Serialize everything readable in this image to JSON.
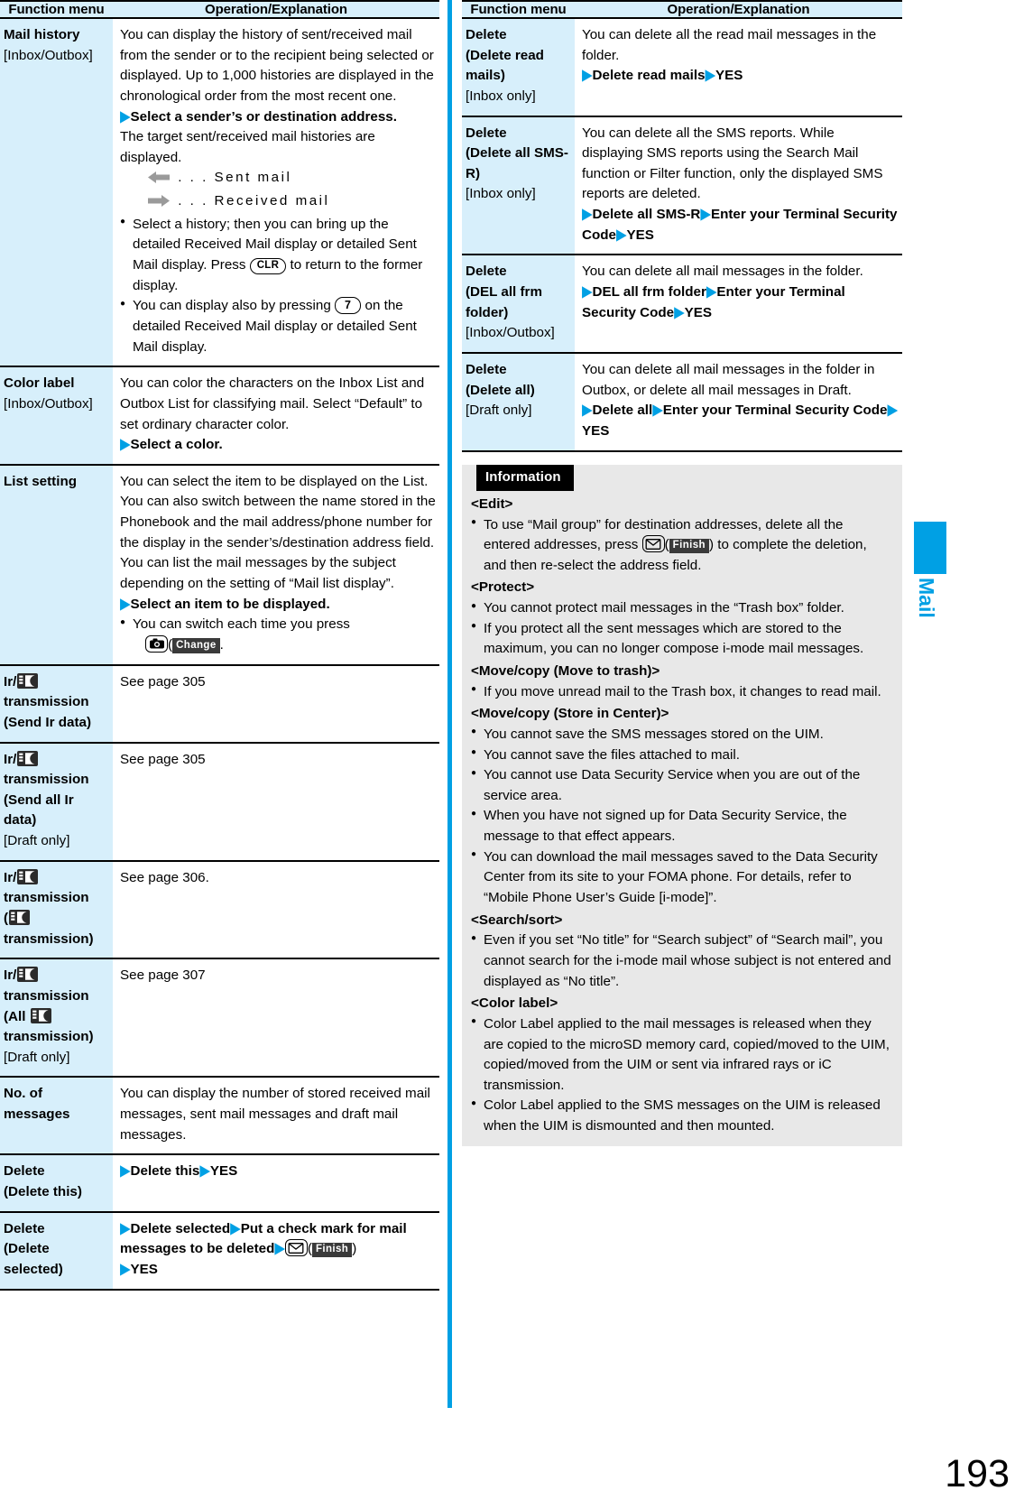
{
  "page": {
    "number": "193",
    "side_tab_label": "Mail"
  },
  "table_headers": {
    "function_menu": "Function menu",
    "operation": "Operation/Explanation"
  },
  "left_column": {
    "rows": [
      {
        "menu_title": "Mail history",
        "menu_scope": "[Inbox/Outbox]",
        "para1": "You can display the history of sent/received mail from the sender or to the recipient being selected or displayed. Up to 1,000 histories are displayed in the chronological order from the most recent one.",
        "step1": "Select a sender’s or destination address.",
        "para2": "The target sent/received mail histories are displayed.",
        "legend_sent": ". . . Sent mail",
        "legend_received": ". . . Received mail",
        "bullet1_a": "Select a history; then you can bring up the detailed Received Mail display or detailed Sent Mail display. Press ",
        "bullet1_key": "CLR",
        "bullet1_b": " to return to the former display.",
        "bullet2_a": "You can display also by pressing ",
        "bullet2_key": "7",
        "bullet2_b": " on the detailed Received Mail display or detailed Sent Mail display."
      },
      {
        "menu_title": "Color label",
        "menu_scope": "[Inbox/Outbox]",
        "para1": "You can color the characters on the Inbox List and Outbox List for classifying mail. Select “Default” to set ordinary character color.",
        "step1": "Select a color."
      },
      {
        "menu_title": "List setting",
        "menu_scope": "",
        "para1": "You can select the item to be displayed on the List. You can also switch between the name stored in the Phonebook and the mail address/phone number for the display in the sender’s/destination address field.",
        "para2": "You can list the mail messages by the subject depending on the setting of “Mail list display”.",
        "step1": "Select an item to be displayed.",
        "bullet1_a": "You can switch each time you press",
        "bullet1_key_icon": "camera-key",
        "bullet1_softkey": "Change",
        "bullet1_b": "."
      },
      {
        "menu_title_pre": "Ir/",
        "menu_icon": "ic-transmission-icon",
        "menu_title_post": "transmission",
        "menu_sub": "(Send Ir data)",
        "menu_scope": "",
        "para1": "See page 305"
      },
      {
        "menu_title_pre": "Ir/",
        "menu_icon": "ic-transmission-icon",
        "menu_title_post": "transmission",
        "menu_sub": "(Send all Ir data)",
        "menu_scope": "[Draft only]",
        "para1": "See page 305"
      },
      {
        "menu_title_pre": "Ir/",
        "menu_icon": "ic-transmission-icon",
        "menu_title_post": "transmission",
        "menu_sub_pre": "(",
        "menu_sub_icon": "ic-transmission-icon",
        "menu_sub_post": "transmission)",
        "menu_scope": "",
        "para1": "See page 306."
      },
      {
        "menu_title_pre": "Ir/",
        "menu_icon": "ic-transmission-icon",
        "menu_title_post": "transmission",
        "menu_sub_pre": "(All ",
        "menu_sub_icon": "ic-transmission-icon",
        "menu_sub_post": "transmission)",
        "menu_scope": "[Draft only]",
        "para1": "See page 307"
      },
      {
        "menu_title": "No. of messages",
        "menu_scope": "",
        "para1": "You can display the number of stored received mail messages, sent mail messages and draft mail messages."
      },
      {
        "menu_title": "Delete",
        "menu_sub": "(Delete this)",
        "menu_scope": "",
        "step_a": "Delete this",
        "step_b": "YES"
      },
      {
        "menu_title": "Delete",
        "menu_sub": "(Delete selected)",
        "menu_scope": "",
        "step_a": "Delete selected",
        "step_b": "Put a check mark for mail messages to be deleted",
        "step_key_icon": "mail-key",
        "step_softkey": "Finish",
        "step_c": "YES"
      }
    ]
  },
  "right_column": {
    "rows": [
      {
        "menu_title": "Delete",
        "menu_sub": "(Delete read mails)",
        "menu_scope": "[Inbox only]",
        "para1": "You can delete all the read mail messages in the folder.",
        "step_a": "Delete read mails",
        "step_b": "YES"
      },
      {
        "menu_title": "Delete",
        "menu_sub": "(Delete all SMS-R)",
        "menu_scope": "[Inbox only]",
        "para1": "You can delete all the SMS reports. While displaying SMS reports using the Search Mail function or Filter function, only the displayed SMS reports are deleted.",
        "step_a": "Delete all SMS-R",
        "step_b": "Enter your Terminal Security Code",
        "step_c": "YES"
      },
      {
        "menu_title": "Delete",
        "menu_sub": "(DEL all frm folder)",
        "menu_scope": "[Inbox/Outbox]",
        "para1": "You can delete all mail messages in the folder.",
        "step_a": "DEL all frm folder",
        "step_b": "Enter your Terminal Security Code",
        "step_c": "YES"
      },
      {
        "menu_title": "Delete",
        "menu_sub": "(Delete all)",
        "menu_scope": "[Draft only]",
        "para1": "You can delete all mail messages in the folder in Outbox, or delete all mail messages in Draft.",
        "step_a": "Delete all",
        "step_b": "Enter your Terminal Security Code",
        "step_c": "YES"
      }
    ],
    "information": {
      "banner": "Information",
      "sections": [
        {
          "heading": "<Edit>",
          "items": [
            {
              "text_a": "To use “Mail group” for destination addresses, delete all the entered addresses, press ",
              "key_icon": "mail-key",
              "softkey": "Finish",
              "text_b": " to complete the deletion, and then re-select the address field."
            }
          ]
        },
        {
          "heading": "<Protect>",
          "items": [
            {
              "text_a": "You cannot protect mail messages in the “Trash box” folder."
            },
            {
              "text_a": "If you protect all the sent messages which are stored to the maximum, you can no longer compose i-mode mail messages."
            }
          ]
        },
        {
          "heading": "<Move/copy (Move to trash)>",
          "items": [
            {
              "text_a": "If you move unread mail to the Trash box, it changes to read mail."
            }
          ]
        },
        {
          "heading": "<Move/copy (Store in Center)>",
          "items": [
            {
              "text_a": "You cannot save the SMS messages stored on the UIM."
            },
            {
              "text_a": "You cannot save the files attached to mail."
            },
            {
              "text_a": "You cannot use Data Security Service when you are out of the service area."
            },
            {
              "text_a": "When you have not signed up for Data Security Service, the message to that effect appears."
            },
            {
              "text_a": "You can download the mail messages saved to the Data Security Center from its site to your FOMA phone. For details, refer to “Mobile Phone User’s Guide [i-mode]”."
            }
          ]
        },
        {
          "heading": "<Search/sort>",
          "items": [
            {
              "text_a": "Even if you set “No title” for “Search subject” of “Search mail”, you cannot search for the i-mode mail whose subject is not entered and displayed as “No title”."
            }
          ]
        },
        {
          "heading": "<Color label>",
          "items": [
            {
              "text_a": "Color Label applied to the mail messages is released when they are copied to the microSD memory card, copied/moved to the UIM, copied/moved from the UIM or sent via infrared rays or iC transmission."
            },
            {
              "text_a": "Color Label applied to the SMS messages on the UIM is released when the UIM is dismounted and then mounted."
            }
          ]
        }
      ]
    }
  },
  "colors": {
    "accent_blue": "#00a0e4",
    "menu_cell_bg": "#d7effb",
    "info_bg": "#e8e8e8"
  }
}
